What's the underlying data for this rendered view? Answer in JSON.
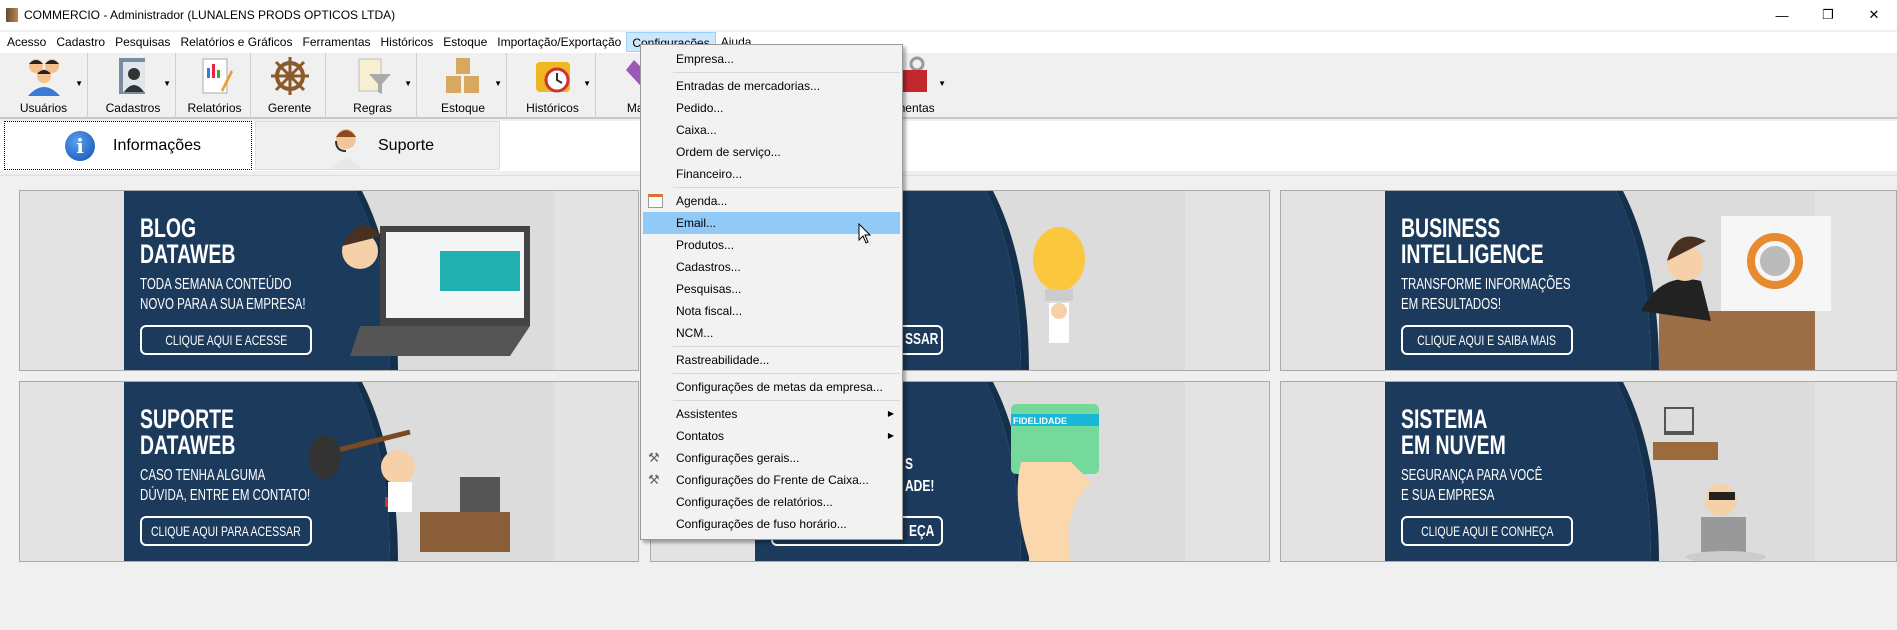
{
  "window": {
    "title": "COMMERCIO - Administrador (LUNALENS PRODS OPTICOS LTDA)",
    "minimize": "—",
    "restore": "❐",
    "close": "✕"
  },
  "menubar": [
    "Acesso",
    "Cadastro",
    "Pesquisas",
    "Relatórios e Gráficos",
    "Ferramentas",
    "Históricos",
    "Estoque",
    "Importação/Exportação",
    "Configurações",
    "Ajuda"
  ],
  "toolbar": [
    {
      "label": "Usuários",
      "icon": "users-icon",
      "dropdown": true
    },
    {
      "label": "Cadastros",
      "icon": "contacts-icon",
      "dropdown": true
    },
    {
      "label": "Relatórios",
      "icon": "report-icon",
      "dropdown": false
    },
    {
      "label": "Gerente",
      "icon": "ship-wheel-icon",
      "dropdown": false
    },
    {
      "label": "Regras",
      "icon": "funnel-icon",
      "dropdown": true
    },
    {
      "label": "Estoque",
      "icon": "boxes-icon",
      "dropdown": true
    },
    {
      "label": "Históricos",
      "icon": "history-folder-icon",
      "dropdown": true
    },
    {
      "label": "Marca",
      "icon": "tag-icon",
      "dropdown": false
    },
    {
      "label": "mentas",
      "icon": "toolbox-icon",
      "dropdown": true
    }
  ],
  "tabs": [
    {
      "label": "Informações",
      "icon": "info-icon"
    },
    {
      "label": "Suporte",
      "icon": "support-agent-icon"
    }
  ],
  "banners": [
    {
      "title1": "BLOG",
      "title2": "DATAWEB",
      "sub1": "TODA SEMANA CONTEÚDO",
      "sub2": "NOVO PARA A SUA EMPRESA!",
      "button": "CLIQUE AQUI E ACESSE"
    },
    {
      "visible_button_fragment": "SSAR"
    },
    {
      "title1": "BUSINESS",
      "title2": "INTELLIGENCE",
      "sub1": "TRANSFORME INFORMAÇÕES",
      "sub2": "EM RESULTADOS!",
      "button": "CLIQUE AQUI E SAIBA MAIS"
    },
    {
      "title1": "SUPORTE",
      "title2": "DATAWEB",
      "sub1": "CASO TENHA ALGUMA",
      "sub2": "DÚVIDA, ENTRE EM CONTATO!",
      "button": "CLIQUE AQUI PARA ACESSAR"
    },
    {
      "visible_fragment1": "S",
      "visible_fragment2": "ADE!",
      "visible_button_fragment": "EÇA",
      "card_label": "FIDELIDADE"
    },
    {
      "title1": "SISTEMA",
      "title2": "EM NUVEM",
      "sub1": "SEGURANÇA PARA VOCÊ",
      "sub2": "E SUA EMPRESA",
      "button": "CLIQUE AQUI E CONHEÇA"
    }
  ],
  "menu": {
    "items": [
      "Empresa...",
      "Entradas de mercadorias...",
      "Pedido...",
      "Caixa...",
      "Ordem de serviço...",
      "Financeiro...",
      "Agenda...",
      "Email...",
      "Produtos...",
      "Cadastros...",
      "Pesquisas...",
      "Nota fiscal...",
      "NCM...",
      "Rastreabilidade...",
      "Configurações de metas da empresa...",
      "Assistentes",
      "Contatos",
      "Configurações gerais...",
      "Configurações do Frente de Caixa...",
      "Configurações de relatórios...",
      "Configurações de fuso horário..."
    ],
    "highlighted": "Email..."
  },
  "colors": {
    "banner_blue": "#1b3a5c",
    "menu_highlight": "#91c9f7"
  }
}
